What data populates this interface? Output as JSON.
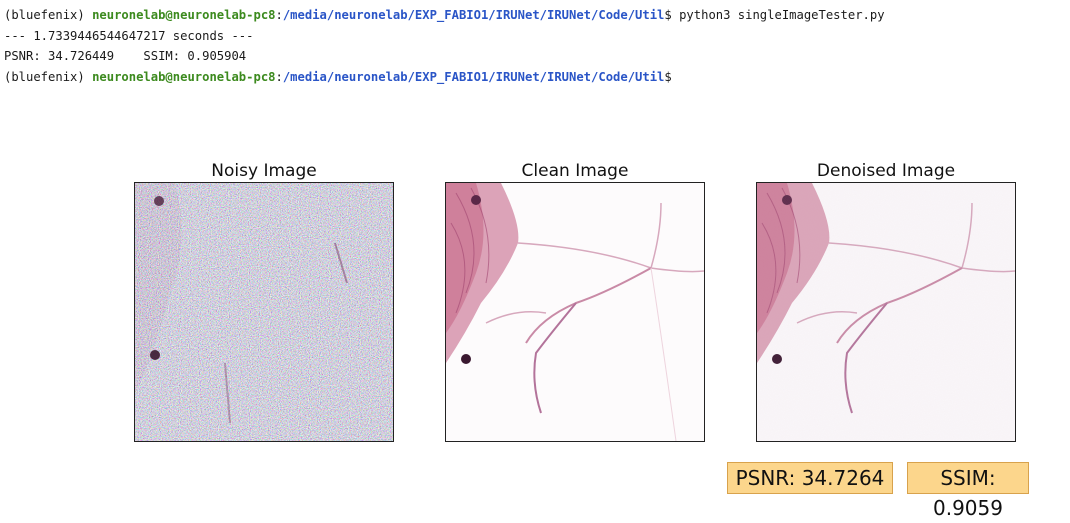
{
  "terminal": {
    "line1": {
      "env": "(bluefenix) ",
      "user": "neuronelab@neuronelab-pc8",
      "sep": ":",
      "path": "/media/neuronelab/EXP_FABIO1/IRUNet/IRUNet/Code/Util",
      "prompt": "$ ",
      "command": "python3 singleImageTester.py"
    },
    "line2": "--- 1.7339446544647217 seconds ---",
    "line3": "PSNR: 34.726449    SSIM: 0.905904",
    "line4": {
      "env": "(bluefenix) ",
      "user": "neuronelab@neuronelab-pc8",
      "sep": ":",
      "path": "/media/neuronelab/EXP_FABIO1/IRUNet/IRUNet/Code/Util",
      "prompt": "$"
    }
  },
  "figure": {
    "panels": [
      {
        "title": "Noisy Image"
      },
      {
        "title": "Clean Image"
      },
      {
        "title": "Denoised Image"
      }
    ],
    "psnr_label": "PSNR: 34.7264",
    "ssim_label": "SSIM: 0.9059"
  },
  "colors": {
    "user": "#3c8a1e",
    "path": "#2a55c7",
    "tissue": "#c9708f",
    "metric_box": "#fcd68c"
  }
}
